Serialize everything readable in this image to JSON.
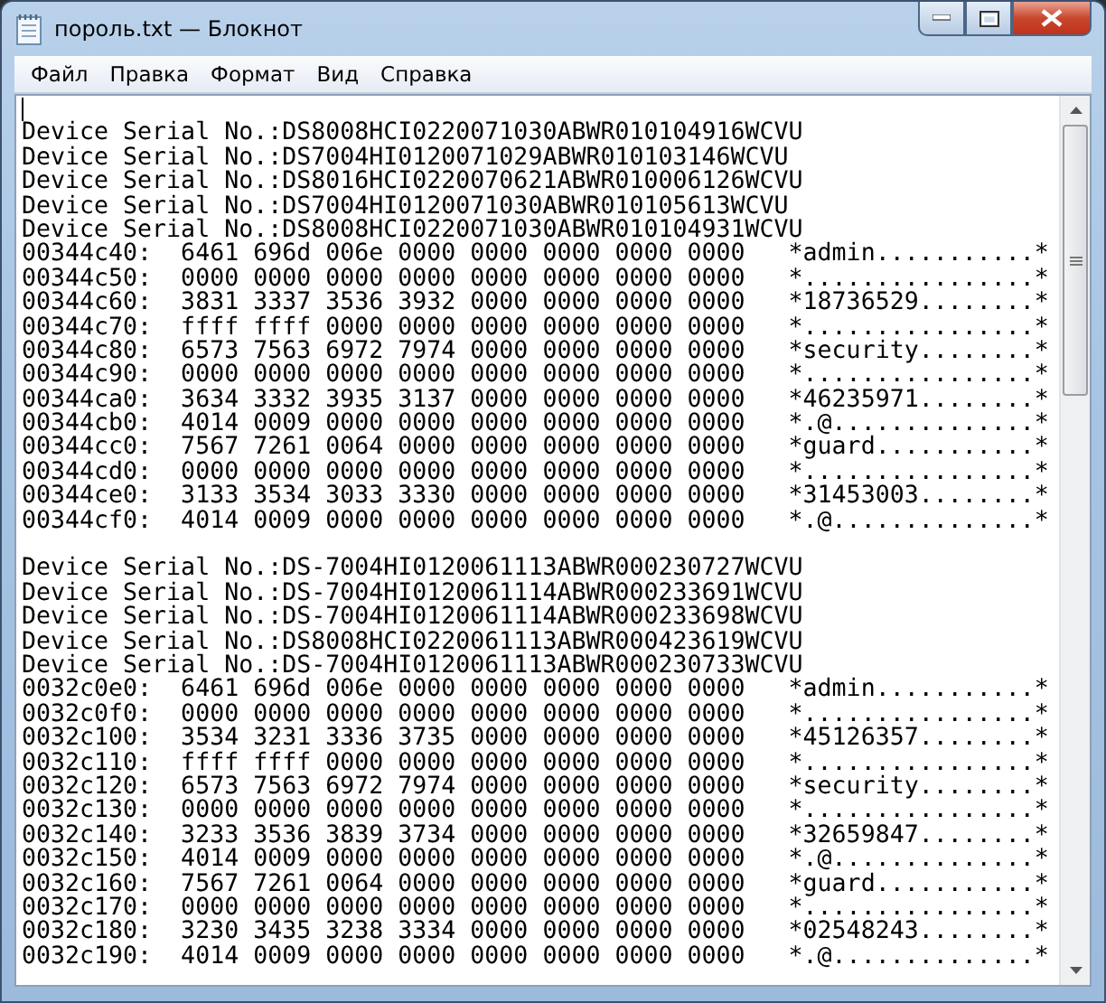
{
  "window": {
    "title": "пороль.txt — Блокнот"
  },
  "menu": [
    "Файл",
    "Правка",
    "Формат",
    "Вид",
    "Справка"
  ],
  "blocks": [
    {
      "lines": [
        "Device Serial No.:DS8008HCI0220071030ABWR010104916WCVU",
        "Device Serial No.:DS7004HI0120071029ABWR010103146WCVU",
        "Device Serial No.:DS8016HCI0220070621ABWR010006126WCVU",
        "Device Serial No.:DS7004HI0120071030ABWR010105613WCVU",
        "Device Serial No.:DS8008HCI0220071030ABWR010104931WCVU",
        "00344c40:  6461 696d 006e 0000 0000 0000 0000 0000   *admin...........*",
        "00344c50:  0000 0000 0000 0000 0000 0000 0000 0000   *................*",
        "00344c60:  3831 3337 3536 3932 0000 0000 0000 0000   *18736529........*",
        "00344c70:  ffff ffff 0000 0000 0000 0000 0000 0000   *................*",
        "00344c80:  6573 7563 6972 7974 0000 0000 0000 0000   *security........*",
        "00344c90:  0000 0000 0000 0000 0000 0000 0000 0000   *................*",
        "00344ca0:  3634 3332 3935 3137 0000 0000 0000 0000   *46235971........*",
        "00344cb0:  4014 0009 0000 0000 0000 0000 0000 0000   *.@..............*",
        "00344cc0:  7567 7261 0064 0000 0000 0000 0000 0000   *guard...........*",
        "00344cd0:  0000 0000 0000 0000 0000 0000 0000 0000   *................*",
        "00344ce0:  3133 3534 3033 3330 0000 0000 0000 0000   *31453003........*",
        "00344cf0:  4014 0009 0000 0000 0000 0000 0000 0000   *.@..............*"
      ]
    },
    {
      "lines": [
        "Device Serial No.:DS-7004HI0120061113ABWR000230727WCVU",
        "Device Serial No.:DS-7004HI0120061114ABWR000233691WCVU",
        "Device Serial No.:DS-7004HI0120061114ABWR000233698WCVU",
        "Device Serial No.:DS8008HCI0220061113ABWR000423619WCVU",
        "Device Serial No.:DS-7004HI0120061113ABWR000230733WCVU",
        "0032c0e0:  6461 696d 006e 0000 0000 0000 0000 0000   *admin...........*",
        "0032c0f0:  0000 0000 0000 0000 0000 0000 0000 0000   *................*",
        "0032c100:  3534 3231 3336 3735 0000 0000 0000 0000   *45126357........*",
        "0032c110:  ffff ffff 0000 0000 0000 0000 0000 0000   *................*",
        "0032c120:  6573 7563 6972 7974 0000 0000 0000 0000   *security........*",
        "0032c130:  0000 0000 0000 0000 0000 0000 0000 0000   *................*",
        "0032c140:  3233 3536 3839 3734 0000 0000 0000 0000   *32659847........*",
        "0032c150:  4014 0009 0000 0000 0000 0000 0000 0000   *.@..............*",
        "0032c160:  7567 7261 0064 0000 0000 0000 0000 0000   *guard...........*",
        "0032c170:  0000 0000 0000 0000 0000 0000 0000 0000   *................*",
        "0032c180:  3230 3435 3238 3334 0000 0000 0000 0000   *02548243........*",
        "0032c190:  4014 0009 0000 0000 0000 0000 0000 0000   *.@..............*"
      ]
    }
  ]
}
